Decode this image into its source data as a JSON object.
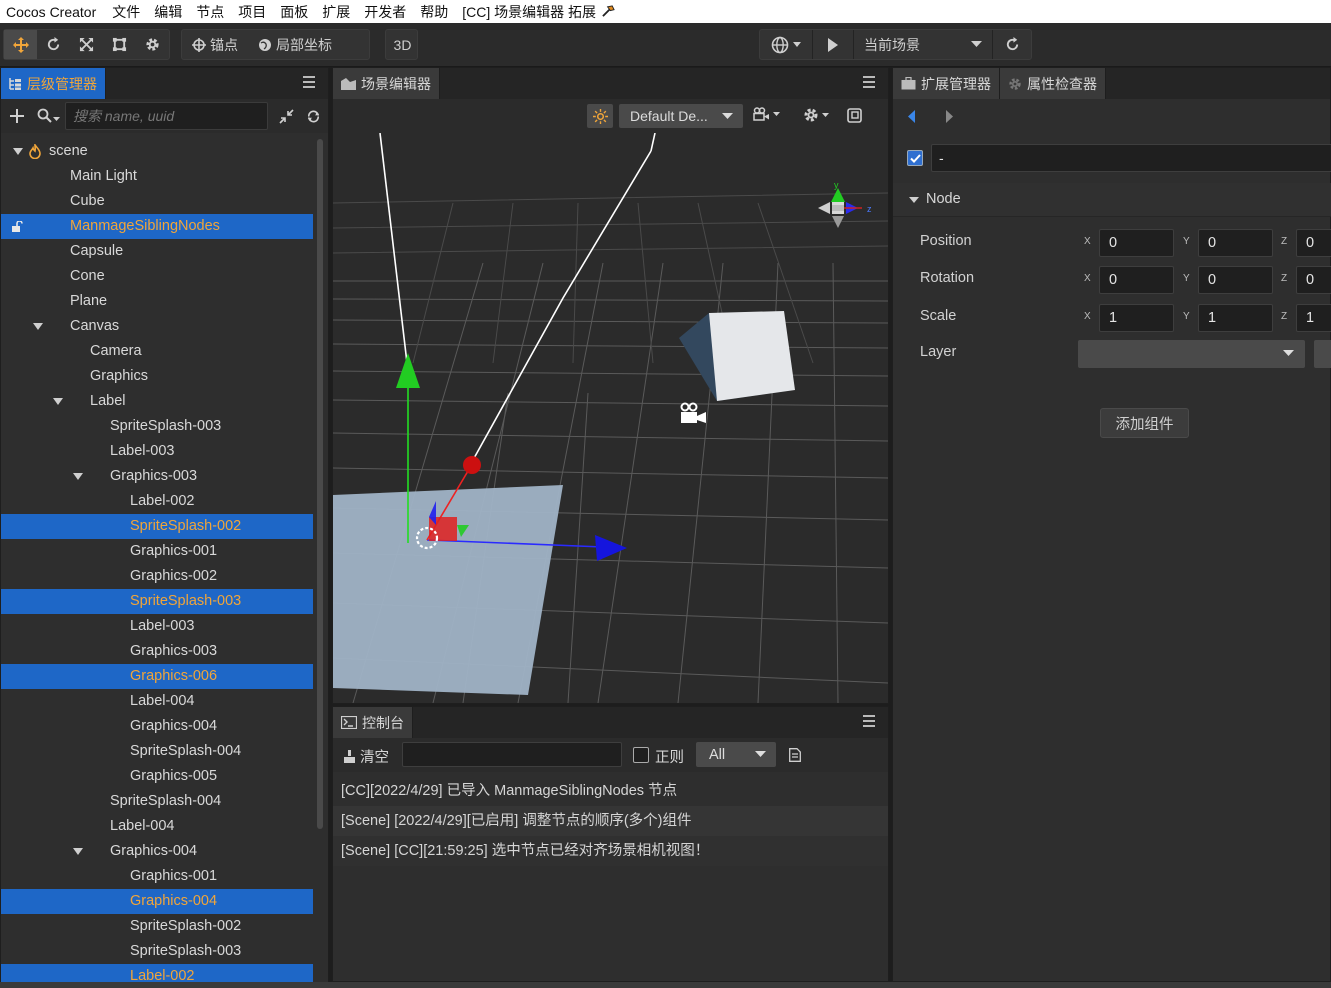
{
  "menubar": {
    "app_name": "Cocos Creator",
    "items": [
      "文件",
      "编辑",
      "节点",
      "项目",
      "面板",
      "扩展",
      "开发者",
      "帮助"
    ],
    "extension_title": "[CC] 场景编辑器 拓展"
  },
  "toolbar": {
    "anchor_label": "锚点",
    "local_coord_label": "局部坐标",
    "mode_3d_label": "3D",
    "current_scene_label": "当前场景"
  },
  "hierarchy": {
    "tab_label": "层级管理器",
    "search_placeholder": "搜索 name, uuid",
    "nodes": [
      {
        "label": "scene",
        "depth": 0,
        "expanded": true,
        "icon": "scene-flame-icon"
      },
      {
        "label": "Main Light",
        "depth": 1
      },
      {
        "label": "Cube",
        "depth": 1
      },
      {
        "label": "ManmageSiblingNodes",
        "depth": 1,
        "selected": true,
        "locked": true
      },
      {
        "label": "Capsule",
        "depth": 1
      },
      {
        "label": "Cone",
        "depth": 1
      },
      {
        "label": "Plane",
        "depth": 1
      },
      {
        "label": "Canvas",
        "depth": 1,
        "expanded": true
      },
      {
        "label": "Camera",
        "depth": 2
      },
      {
        "label": "Graphics",
        "depth": 2
      },
      {
        "label": "Label",
        "depth": 2,
        "expanded": true
      },
      {
        "label": "SpriteSplash-003",
        "depth": 3
      },
      {
        "label": "Label-003",
        "depth": 3
      },
      {
        "label": "Graphics-003",
        "depth": 3,
        "expanded": true
      },
      {
        "label": "Label-002",
        "depth": 4
      },
      {
        "label": "SpriteSplash-002",
        "depth": 4,
        "selected": true
      },
      {
        "label": "Graphics-001",
        "depth": 4
      },
      {
        "label": "Graphics-002",
        "depth": 4
      },
      {
        "label": "SpriteSplash-003",
        "depth": 4,
        "selected": true
      },
      {
        "label": "Label-003",
        "depth": 4
      },
      {
        "label": "Graphics-003",
        "depth": 4
      },
      {
        "label": "Graphics-006",
        "depth": 4,
        "selected": true
      },
      {
        "label": "Label-004",
        "depth": 4
      },
      {
        "label": "Graphics-004",
        "depth": 4
      },
      {
        "label": "SpriteSplash-004",
        "depth": 4
      },
      {
        "label": "Graphics-005",
        "depth": 4
      },
      {
        "label": "SpriteSplash-004",
        "depth": 3
      },
      {
        "label": "Label-004",
        "depth": 3
      },
      {
        "label": "Graphics-004",
        "depth": 3,
        "expanded": true
      },
      {
        "label": "Graphics-001",
        "depth": 4
      },
      {
        "label": "Graphics-004",
        "depth": 4,
        "selected": true
      },
      {
        "label": "SpriteSplash-002",
        "depth": 4
      },
      {
        "label": "SpriteSplash-003",
        "depth": 4
      },
      {
        "label": "Label-002",
        "depth": 4,
        "selected": true
      }
    ]
  },
  "scene_editor": {
    "tab_label": "场景编辑器",
    "camera_select": "Default De...",
    "gizmo_axes": {
      "y": "y",
      "z": "z"
    }
  },
  "console": {
    "tab_label": "控制台",
    "clear_label": "清空",
    "regex_label": "正则",
    "filter_value": "All",
    "logs": [
      "[CC][2022/4/29] 已导入 ManmageSiblingNodes 节点",
      "[Scene] [2022/4/29][已启用] 调整节点的顺序(多个)组件",
      "[Scene] [CC][21:59:25] 选中节点已经对齐场景相机视图！"
    ]
  },
  "inspector": {
    "tabs": [
      "扩展管理器",
      "属性检查器"
    ],
    "node_name": "-",
    "section_title": "Node",
    "axis_labels": [
      "X",
      "Y",
      "Z"
    ],
    "properties": [
      {
        "label": "Position",
        "values": [
          "0",
          "0",
          "0"
        ]
      },
      {
        "label": "Rotation",
        "values": [
          "0",
          "0",
          "0"
        ]
      },
      {
        "label": "Scale",
        "values": [
          "1",
          "1",
          "1"
        ]
      }
    ],
    "layer_label": "Layer",
    "add_component_label": "添加组件"
  },
  "colors": {
    "accent_orange": "#f0a53a",
    "selection_blue": "#1e67c7"
  }
}
